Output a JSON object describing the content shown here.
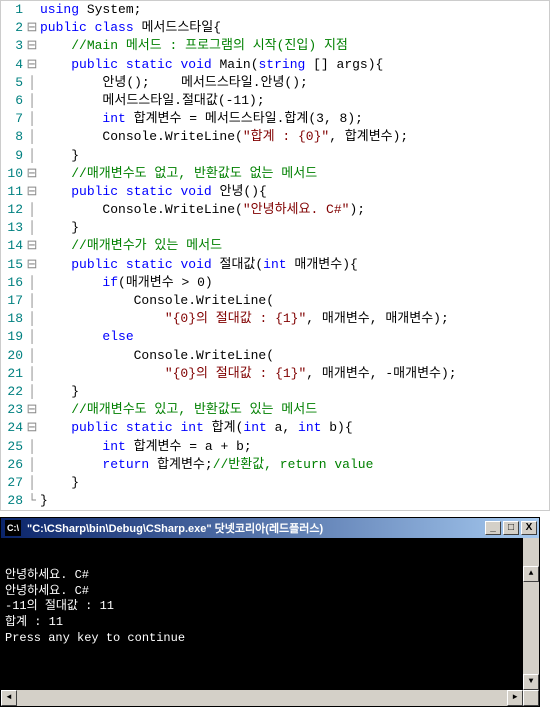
{
  "code": {
    "lines": [
      {
        "n": "1",
        "fold": " ",
        "tokens": [
          {
            "c": "kw",
            "t": "using"
          },
          {
            "c": "txt",
            "t": " System;"
          }
        ]
      },
      {
        "n": "2",
        "fold": "⊟",
        "tokens": [
          {
            "c": "kw",
            "t": "public"
          },
          {
            "c": "txt",
            "t": " "
          },
          {
            "c": "kw",
            "t": "class"
          },
          {
            "c": "txt",
            "t": " 메서드스타일{"
          }
        ]
      },
      {
        "n": "3",
        "fold": "⊟",
        "tokens": [
          {
            "c": "txt",
            "t": "    "
          },
          {
            "c": "com",
            "t": "//Main 메서드 : 프로그램의 시작(진입) 지점"
          }
        ]
      },
      {
        "n": "4",
        "fold": "⊟",
        "tokens": [
          {
            "c": "txt",
            "t": "    "
          },
          {
            "c": "kw",
            "t": "public"
          },
          {
            "c": "txt",
            "t": " "
          },
          {
            "c": "kw",
            "t": "static"
          },
          {
            "c": "txt",
            "t": " "
          },
          {
            "c": "kw",
            "t": "void"
          },
          {
            "c": "txt",
            "t": " Main("
          },
          {
            "c": "kw",
            "t": "string"
          },
          {
            "c": "txt",
            "t": " [] args){"
          }
        ]
      },
      {
        "n": "5",
        "fold": "│",
        "tokens": [
          {
            "c": "txt",
            "t": "        안녕();    메서드스타일.안녕();"
          }
        ]
      },
      {
        "n": "6",
        "fold": "│",
        "tokens": [
          {
            "c": "txt",
            "t": "        메서드스타일.절대값(-11);"
          }
        ]
      },
      {
        "n": "7",
        "fold": "│",
        "tokens": [
          {
            "c": "txt",
            "t": "        "
          },
          {
            "c": "kw",
            "t": "int"
          },
          {
            "c": "txt",
            "t": " 합계변수 = 메서드스타일.합계(3, 8);"
          }
        ]
      },
      {
        "n": "8",
        "fold": "│",
        "tokens": [
          {
            "c": "txt",
            "t": "        Console.WriteLine("
          },
          {
            "c": "str",
            "t": "\"합계 : {0}\""
          },
          {
            "c": "txt",
            "t": ", 합계변수);"
          }
        ]
      },
      {
        "n": "9",
        "fold": "│",
        "tokens": [
          {
            "c": "txt",
            "t": "    }"
          }
        ]
      },
      {
        "n": "10",
        "fold": "⊟",
        "tokens": [
          {
            "c": "txt",
            "t": "    "
          },
          {
            "c": "com",
            "t": "//매개변수도 없고, 반환값도 없는 메서드"
          }
        ]
      },
      {
        "n": "11",
        "fold": "⊟",
        "tokens": [
          {
            "c": "txt",
            "t": "    "
          },
          {
            "c": "kw",
            "t": "public"
          },
          {
            "c": "txt",
            "t": " "
          },
          {
            "c": "kw",
            "t": "static"
          },
          {
            "c": "txt",
            "t": " "
          },
          {
            "c": "kw",
            "t": "void"
          },
          {
            "c": "txt",
            "t": " 안녕(){"
          }
        ]
      },
      {
        "n": "12",
        "fold": "│",
        "tokens": [
          {
            "c": "txt",
            "t": "        Console.WriteLine("
          },
          {
            "c": "str",
            "t": "\"안녕하세요. C#\""
          },
          {
            "c": "txt",
            "t": ");"
          }
        ]
      },
      {
        "n": "13",
        "fold": "│",
        "tokens": [
          {
            "c": "txt",
            "t": "    }"
          }
        ]
      },
      {
        "n": "14",
        "fold": "⊟",
        "tokens": [
          {
            "c": "txt",
            "t": "    "
          },
          {
            "c": "com",
            "t": "//매개변수가 있는 메서드"
          }
        ]
      },
      {
        "n": "15",
        "fold": "⊟",
        "tokens": [
          {
            "c": "txt",
            "t": "    "
          },
          {
            "c": "kw",
            "t": "public"
          },
          {
            "c": "txt",
            "t": " "
          },
          {
            "c": "kw",
            "t": "static"
          },
          {
            "c": "txt",
            "t": " "
          },
          {
            "c": "kw",
            "t": "void"
          },
          {
            "c": "txt",
            "t": " 절대값("
          },
          {
            "c": "kw",
            "t": "int"
          },
          {
            "c": "txt",
            "t": " 매개변수){"
          }
        ]
      },
      {
        "n": "16",
        "fold": "│",
        "tokens": [
          {
            "c": "txt",
            "t": "        "
          },
          {
            "c": "kw",
            "t": "if"
          },
          {
            "c": "txt",
            "t": "(매개변수 > 0)"
          }
        ]
      },
      {
        "n": "17",
        "fold": "│",
        "tokens": [
          {
            "c": "txt",
            "t": "            Console.WriteLine("
          }
        ]
      },
      {
        "n": "18",
        "fold": "│",
        "tokens": [
          {
            "c": "txt",
            "t": "                "
          },
          {
            "c": "str",
            "t": "\"{0}의 절대값 : {1}\""
          },
          {
            "c": "txt",
            "t": ", 매개변수, 매개변수);"
          }
        ]
      },
      {
        "n": "19",
        "fold": "│",
        "tokens": [
          {
            "c": "txt",
            "t": "        "
          },
          {
            "c": "kw",
            "t": "else"
          }
        ]
      },
      {
        "n": "20",
        "fold": "│",
        "tokens": [
          {
            "c": "txt",
            "t": "            Console.WriteLine("
          }
        ]
      },
      {
        "n": "21",
        "fold": "│",
        "tokens": [
          {
            "c": "txt",
            "t": "                "
          },
          {
            "c": "str",
            "t": "\"{0}의 절대값 : {1}\""
          },
          {
            "c": "txt",
            "t": ", 매개변수, -매개변수);"
          }
        ]
      },
      {
        "n": "22",
        "fold": "│",
        "tokens": [
          {
            "c": "txt",
            "t": "    }"
          }
        ]
      },
      {
        "n": "23",
        "fold": "⊟",
        "tokens": [
          {
            "c": "txt",
            "t": "    "
          },
          {
            "c": "com",
            "t": "//매개변수도 있고, 반환값도 있는 메서드"
          }
        ]
      },
      {
        "n": "24",
        "fold": "⊟",
        "tokens": [
          {
            "c": "txt",
            "t": "    "
          },
          {
            "c": "kw",
            "t": "public"
          },
          {
            "c": "txt",
            "t": " "
          },
          {
            "c": "kw",
            "t": "static"
          },
          {
            "c": "txt",
            "t": " "
          },
          {
            "c": "kw",
            "t": "int"
          },
          {
            "c": "txt",
            "t": " 합계("
          },
          {
            "c": "kw",
            "t": "int"
          },
          {
            "c": "txt",
            "t": " a, "
          },
          {
            "c": "kw",
            "t": "int"
          },
          {
            "c": "txt",
            "t": " b){"
          }
        ]
      },
      {
        "n": "25",
        "fold": "│",
        "tokens": [
          {
            "c": "txt",
            "t": "        "
          },
          {
            "c": "kw",
            "t": "int"
          },
          {
            "c": "txt",
            "t": " 합계변수 = a + b;"
          }
        ]
      },
      {
        "n": "26",
        "fold": "│",
        "tokens": [
          {
            "c": "txt",
            "t": "        "
          },
          {
            "c": "kw",
            "t": "return"
          },
          {
            "c": "txt",
            "t": " 합계변수;"
          },
          {
            "c": "com",
            "t": "//반환값, return value"
          }
        ]
      },
      {
        "n": "27",
        "fold": "│",
        "tokens": [
          {
            "c": "txt",
            "t": "    }"
          }
        ]
      },
      {
        "n": "28",
        "fold": "└",
        "tokens": [
          {
            "c": "txt",
            "t": "}"
          }
        ]
      }
    ]
  },
  "console": {
    "icon": "C:\\",
    "title": "\"C:\\CSharp\\bin\\Debug\\CSharp.exe\" 닷넷코리아(레드플러스)",
    "buttons": {
      "min": "_",
      "max": "□",
      "close": "X"
    },
    "output": [
      "안녕하세요. C#",
      "안녕하세요. C#",
      "-11의 절대값 : 11",
      "합계 : 11",
      "Press any key to continue"
    ]
  }
}
